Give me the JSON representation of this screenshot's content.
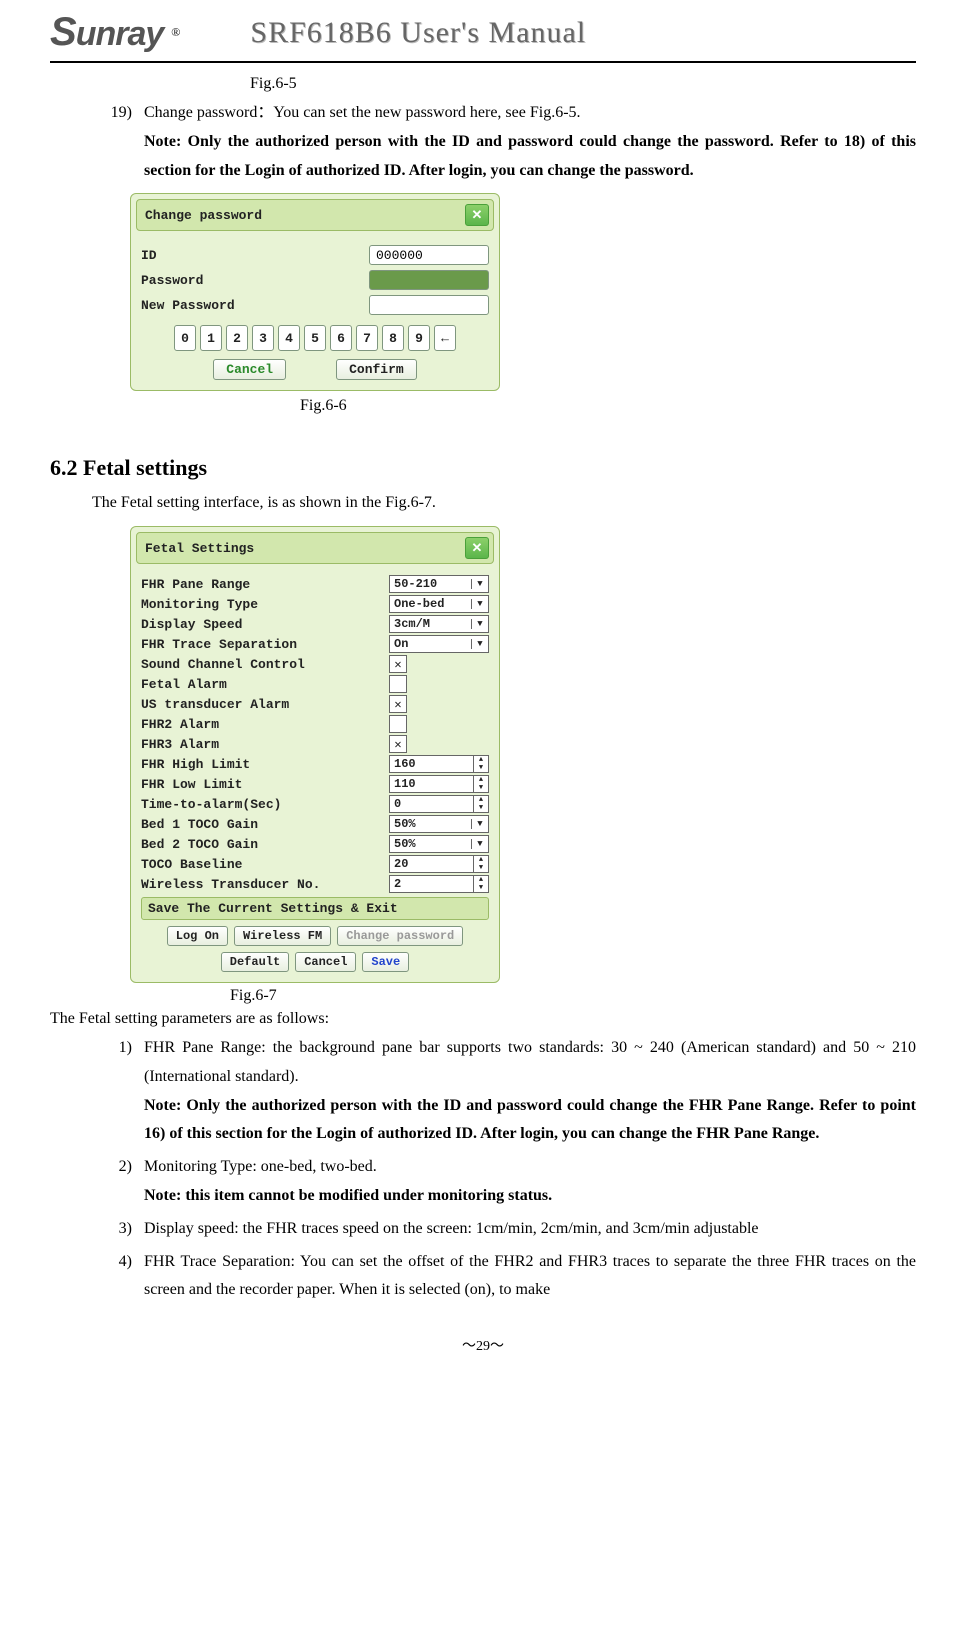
{
  "header": {
    "logo": "unray",
    "logo_s": "S",
    "reg": "®",
    "title": "SRF618B6 User's Manual"
  },
  "fig65_caption": "Fig.6-5",
  "item19": {
    "num": "19)",
    "lead": "Change password：",
    "text": "You can set the new password here, see Fig.6-5.",
    "note": "Note: Only the authorized person with the ID and password could change the password. Refer to 18) of this section for the Login of authorized ID. After login, you can change the password."
  },
  "change_pwd": {
    "title": "Change password",
    "id_label": "ID",
    "id_value": "000000",
    "pwd_label": "Password",
    "newpwd_label": "New Password",
    "keys": [
      "0",
      "1",
      "2",
      "3",
      "4",
      "5",
      "6",
      "7",
      "8",
      "9",
      "←"
    ],
    "cancel": "Cancel",
    "confirm": "Confirm"
  },
  "fig66_caption": "Fig.6-6",
  "section62": {
    "heading": "6.2 Fetal settings",
    "intro": "The Fetal setting interface, is as shown in the Fig.6-7."
  },
  "fetal": {
    "title": "Fetal Settings",
    "rows": [
      {
        "label": "FHR Pane Range",
        "type": "select",
        "value": "50-210"
      },
      {
        "label": "Monitoring Type",
        "type": "select",
        "value": "One-bed"
      },
      {
        "label": "Display Speed",
        "type": "select",
        "value": "3cm/M"
      },
      {
        "label": "FHR Trace Separation",
        "type": "select",
        "value": "On"
      },
      {
        "label": "Sound Channel Control",
        "type": "check",
        "value": "✕"
      },
      {
        "label": "Fetal Alarm",
        "type": "check",
        "value": ""
      },
      {
        "label": "US transducer Alarm",
        "type": "check",
        "value": "✕"
      },
      {
        "label": "FHR2 Alarm",
        "type": "check",
        "value": ""
      },
      {
        "label": "FHR3 Alarm",
        "type": "check",
        "value": "✕"
      },
      {
        "label": "FHR High Limit",
        "type": "spin",
        "value": "160"
      },
      {
        "label": "FHR Low Limit",
        "type": "spin",
        "value": "110"
      },
      {
        "label": "Time-to-alarm(Sec)",
        "type": "spin",
        "value": "0"
      },
      {
        "label": "Bed 1 TOCO Gain",
        "type": "select",
        "value": "50%"
      },
      {
        "label": "Bed 2 TOCO Gain",
        "type": "select",
        "value": "50%"
      },
      {
        "label": "TOCO Baseline",
        "type": "spin",
        "value": "20"
      },
      {
        "label": "Wireless Transducer No.",
        "type": "spin",
        "value": "2"
      }
    ],
    "save_bar": "Save The Current Settings & Exit",
    "buttons": {
      "logon": "Log On",
      "wireless": "Wireless FM",
      "changepwd": "Change password",
      "default": "Default",
      "cancel": "Cancel",
      "save": "Save"
    }
  },
  "fig67_caption": "Fig.6-7",
  "params_intro": "The Fetal setting parameters are as follows:",
  "param1": {
    "num": "1)",
    "text": "FHR Pane Range: the background pane bar supports two standards: 30 ~ 240 (American standard) and 50 ~ 210 (International standard).",
    "note": "Note: Only the authorized person with the ID and password could change the FHR Pane Range. Refer to point 16) of this section for the Login of authorized ID. After login, you can change the FHR Pane Range."
  },
  "param2": {
    "num": "2)",
    "text": "Monitoring Type: one-bed, two-bed.",
    "note": "Note: this item cannot be modified under monitoring status."
  },
  "param3": {
    "num": "3)",
    "text": "Display speed: the FHR traces speed on the screen: 1cm/min, 2cm/min, and 3cm/min adjustable"
  },
  "param4": {
    "num": "4)",
    "text": "FHR Trace Separation: You can set the offset of the FHR2 and FHR3 traces to separate the three FHR traces on the screen and the recorder paper. When it is selected (on), to make"
  },
  "footer": "～29～"
}
